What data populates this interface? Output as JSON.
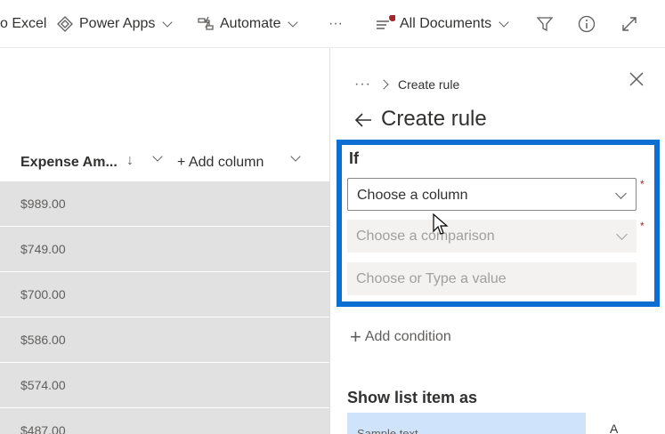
{
  "command_bar": {
    "export_excel": "o Excel",
    "power_apps": "Power Apps",
    "automate": "Automate",
    "more": "···",
    "view": "All Documents",
    "icons": [
      "excel-icon",
      "power-apps-icon",
      "automate-icon",
      "view-list-icon",
      "filter-icon",
      "info-icon",
      "expand-icon"
    ]
  },
  "list": {
    "column_header": "Expense Am...",
    "sort_glyph": "↓",
    "add_column": "+ Add column",
    "rows": [
      "$989.00",
      "$749.00",
      "$700.00",
      "$586.00",
      "$574.00",
      "$487.00"
    ]
  },
  "panel": {
    "breadcrumb_more": "···",
    "breadcrumb_current": "Create rule",
    "title": "Create rule",
    "if_label": "If",
    "column_field": "Choose a column",
    "comparison_field": "Choose a comparison",
    "value_field": "Choose or Type a value",
    "required_marker": "*",
    "add_condition": "Add condition",
    "add_condition_plus": "+",
    "show_as_label": "Show list item as",
    "sample_text": "Sample text",
    "format_label": "A"
  },
  "colors": {
    "highlight": "#0a6fd1",
    "row_bg": "#e1e1e1",
    "sample_bg": "#cfe4fa",
    "required": "#a4262c"
  }
}
